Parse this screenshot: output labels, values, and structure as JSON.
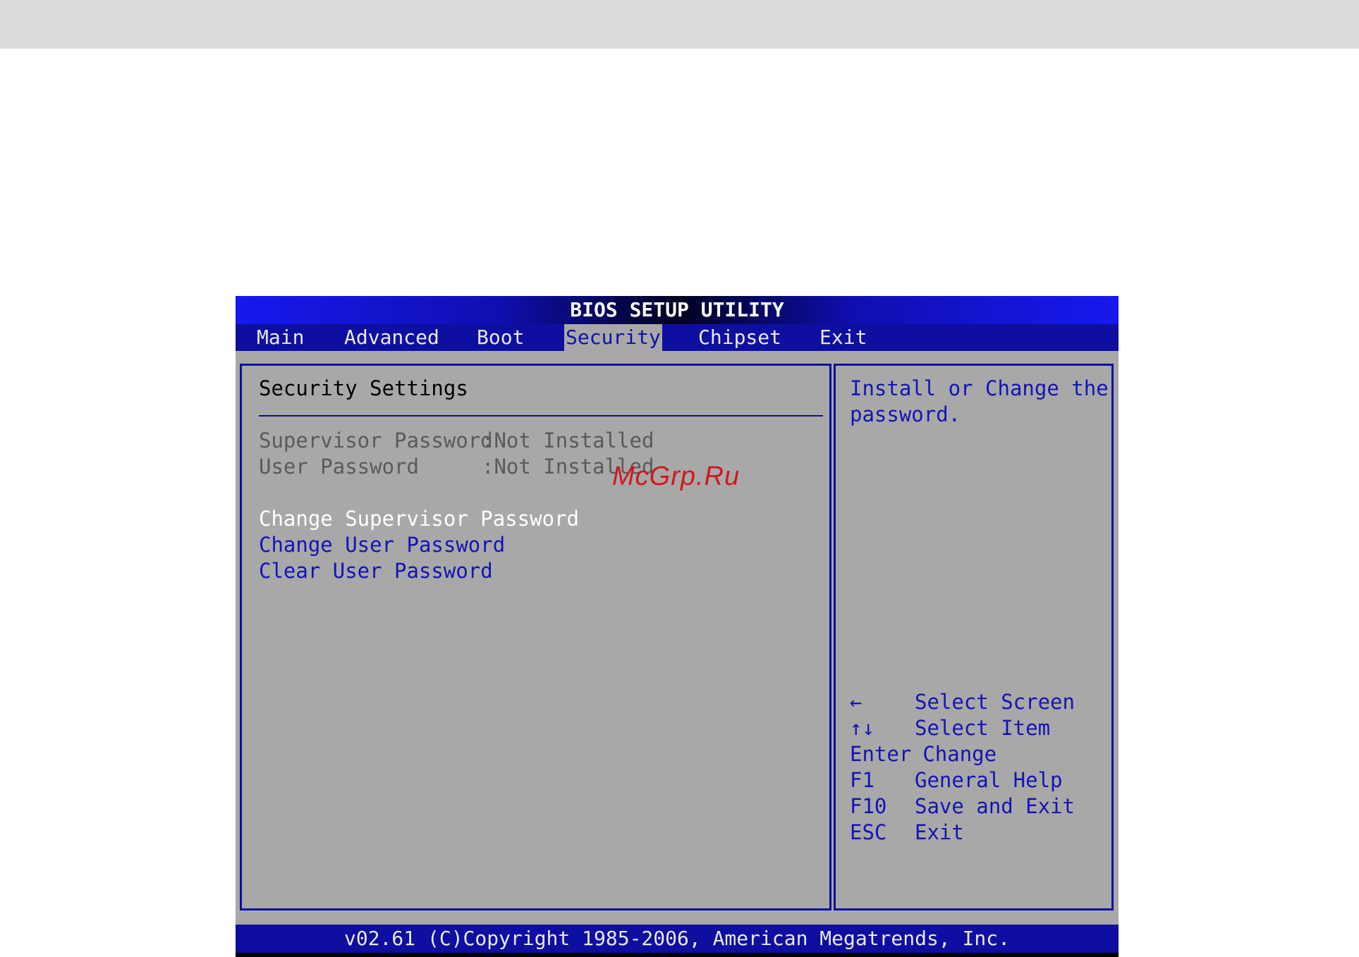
{
  "title": "BIOS SETUP UTILITY",
  "menu": {
    "items": [
      "Main",
      "Advanced",
      "Boot",
      "Security",
      "Chipset",
      "Exit"
    ],
    "active_index": 3
  },
  "main": {
    "heading": "Security Settings",
    "status": [
      {
        "label": "Supervisor Password",
        "value": ":Not Installed"
      },
      {
        "label": "User Password",
        "value": ":Not Installed"
      }
    ],
    "options": [
      "Change Supervisor Password",
      "Change User Password",
      "Clear User Password"
    ],
    "selected_index": 0
  },
  "help": {
    "lines": [
      "Install or Change the",
      "password."
    ],
    "keys": [
      {
        "key": "←",
        "action": "Select Screen"
      },
      {
        "key": "↑↓",
        "action": "Select Item"
      },
      {
        "key": "Enter",
        "action": "Change"
      },
      {
        "key": "F1",
        "action": "General Help"
      },
      {
        "key": "F10",
        "action": "Save and Exit"
      },
      {
        "key": "ESC",
        "action": "Exit"
      }
    ]
  },
  "footer": "v02.61 (C)Copyright 1985-2006, American Megatrends, Inc.",
  "watermark": "McGrp.Ru",
  "colors": {
    "menubar": "#0e0ea0",
    "panel": "#a8a8a8",
    "option_text": "#1414b4",
    "watermark": "#d0181e"
  }
}
